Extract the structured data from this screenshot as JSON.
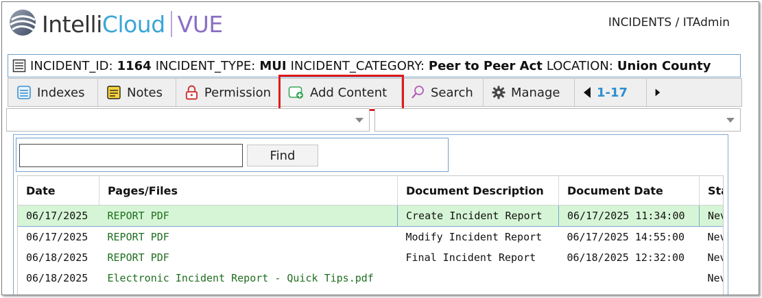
{
  "header": {
    "brand_intelli": "Intelli",
    "brand_cloud": "Cloud",
    "brand_vue": "VUE",
    "breadcrumb": "INCIDENTS / ITAdmin",
    "colors": {
      "cloud": "#3aa6d6",
      "vue": "#8a6fc4"
    }
  },
  "incident": {
    "id_label": "INCIDENT_ID:",
    "id_value": "1164",
    "type_label": "INCIDENT_TYPE:",
    "type_value": "MUI",
    "category_label": "INCIDENT_CATEGORY:",
    "category_value": "Peer to Peer Act",
    "location_label": "LOCATION:",
    "location_value": "Union County"
  },
  "toolbar": {
    "indexes": "Indexes",
    "notes": "Notes",
    "permission": "Permission",
    "add_content": "Add Content",
    "search": "Search",
    "manage": "Manage",
    "range": "1-17",
    "icons": [
      "indexes-icon",
      "notes-icon",
      "lock-icon",
      "add-content-icon",
      "search-icon",
      "gear-icon",
      "prev-arrow-icon",
      "next-arrow-icon"
    ],
    "highlight_color": "#e01b1b"
  },
  "find": {
    "button": "Find",
    "value": ""
  },
  "table": {
    "headers": [
      "Date",
      "Pages/Files",
      "Document Description",
      "Document Date",
      "Sta"
    ],
    "rows": [
      {
        "date": "06/17/2025",
        "file": "REPORT PDF",
        "desc": "Create Incident Report",
        "ddate": "06/17/2025 11:34:00",
        "status": "Nev"
      },
      {
        "date": "06/17/2025",
        "file": "REPORT PDF",
        "desc": "Modify Incident Report",
        "ddate": "06/17/2025 14:55:00",
        "status": "Nev"
      },
      {
        "date": "06/18/2025",
        "file": "REPORT PDF",
        "desc": "Final Incident Report",
        "ddate": "06/18/2025 12:32:00",
        "status": "Nev"
      },
      {
        "date": "06/18/2025",
        "file": "Electronic Incident Report - Quick Tips.pdf",
        "desc": "",
        "ddate": "",
        "status": "Nev"
      }
    ],
    "selected_row_color": "#d6f5d6"
  }
}
